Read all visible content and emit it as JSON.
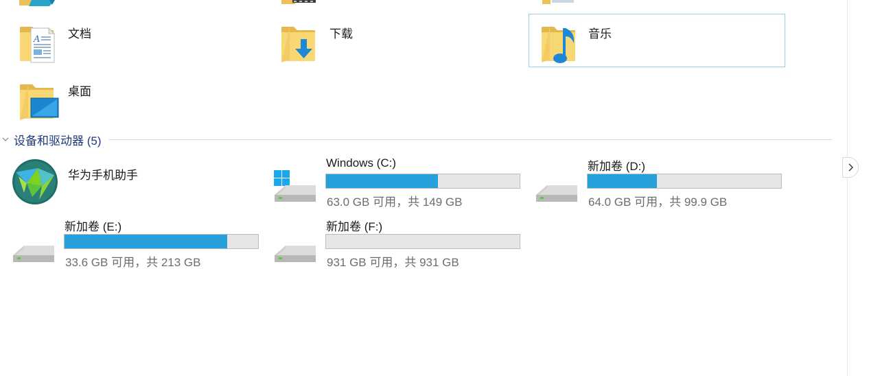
{
  "folders": [
    {
      "label": "文档",
      "icon": "documents-folder-icon"
    },
    {
      "label": "下载",
      "icon": "downloads-folder-icon"
    },
    {
      "label": "音乐",
      "icon": "music-folder-icon",
      "selected": true
    },
    {
      "label": "桌面",
      "icon": "desktop-folder-icon"
    }
  ],
  "devices": {
    "header": "设备和驱动器 (5)",
    "app": {
      "label": "华为手机助手",
      "icon": "huawei-hisuite-icon"
    },
    "drives": [
      {
        "name": "Windows (C:)",
        "space": "63.0 GB 可用，共 149 GB",
        "used_fraction": 0.577,
        "system": true
      },
      {
        "name": "新加卷 (D:)",
        "space": "64.0 GB 可用，共 99.9 GB",
        "used_fraction": 0.359
      },
      {
        "name": "新加卷 (E:)",
        "space": "33.6 GB 可用，共 213 GB",
        "used_fraction": 0.842
      },
      {
        "name": "新加卷 (F:)",
        "space": "931 GB 可用，共 931 GB",
        "used_fraction": 0.0
      }
    ]
  },
  "colors": {
    "accent": "#26a0da",
    "selection_border": "#99d1ea",
    "group_header": "#1e3a7a",
    "folder_yellow": "#f8d775"
  }
}
